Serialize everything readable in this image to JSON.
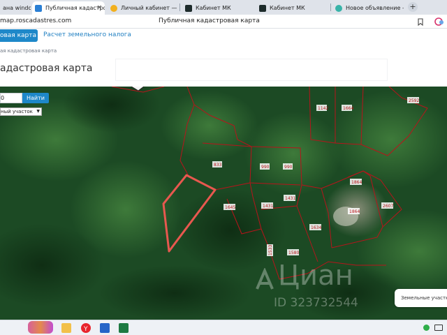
{
  "browser": {
    "tabs": [
      {
        "label": "Яндекс окна windows",
        "visible": "ана windo",
        "active": false
      },
      {
        "label": "Публичная кадастровая карта",
        "visible": "Публичная кадастро",
        "active": true,
        "close": "×"
      },
      {
        "label": "Личный кабинет — Яндекс",
        "visible": "Личный кабинет — Янд",
        "active": false
      },
      {
        "label": "Кабинет МК",
        "visible": "Кабинет МК",
        "active": false
      },
      {
        "label": "Кабинет МК",
        "visible": "Кабинет МК",
        "active": false
      },
      {
        "label": "Новое объявление — Ок",
        "visible": "Новое объявление — Об",
        "active": false
      }
    ],
    "new_tab": "+",
    "url": "map.roscadastres.com",
    "page_title": "Публичная кадастровая карта",
    "icons": [
      "bookmark-icon",
      "extension-icon"
    ]
  },
  "site": {
    "nav": {
      "active": "овая карта",
      "tax": "Расчет земельного налога"
    },
    "breadcrumb": "ая кадастровая карта",
    "heading": "адастровая карта"
  },
  "search": {
    "value": "0",
    "button": "Найти",
    "type": "ный участок"
  },
  "parcels": {
    "p1142": "1142",
    "p1664": "1664",
    "p2592": "2592",
    "p833": "833",
    "p990a": "990",
    "p990b": "990",
    "p1864a": "1864",
    "p1645": "1645",
    "p1431a": "1431",
    "p1431b": "1431",
    "p1864b": "1864",
    "p2607": "2607",
    "p1634": "1634",
    "p1533": "1533",
    "p1580": "1580"
  },
  "watermark": {
    "logo": "Циан",
    "id": "ID 323732544"
  },
  "popup": {
    "text": "Земельные участки н"
  },
  "colors": {
    "accent": "#1e88c9",
    "parcel_line": "#b8141b",
    "highlight": "#e8584f"
  }
}
